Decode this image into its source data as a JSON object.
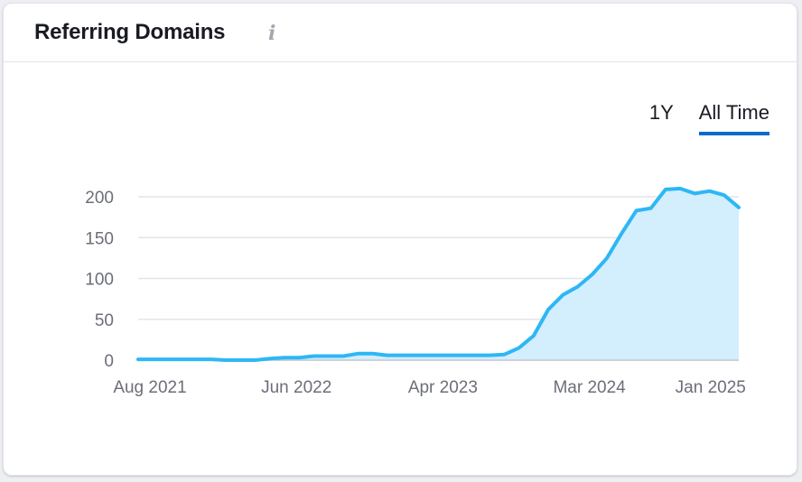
{
  "header": {
    "title": "Referring Domains",
    "info_icon": "info-icon"
  },
  "tabs": [
    {
      "label": "1Y",
      "active": false
    },
    {
      "label": "All Time",
      "active": true
    }
  ],
  "colors": {
    "line": "#2db7f5",
    "fill": "#d3eefc",
    "accent": "#006dca",
    "grid": "#e3e4ea"
  },
  "chart_data": {
    "type": "area",
    "title": "Referring Domains",
    "xlabel": "",
    "ylabel": "",
    "ylim": [
      0,
      200
    ],
    "yticks": [
      0,
      50,
      100,
      150,
      200
    ],
    "ytick_labels": [
      "0",
      "50",
      "100",
      "150",
      "200"
    ],
    "xtick_labels": [
      "Aug 2021",
      "Jun 2022",
      "Apr 2023",
      "Mar 2024",
      "Jan 2025"
    ],
    "xtick_positions": [
      0,
      10,
      20,
      30,
      40
    ],
    "grid": true,
    "legend": "none",
    "series": [
      {
        "name": "Referring Domains",
        "x": [
          0,
          1,
          2,
          3,
          4,
          5,
          6,
          7,
          8,
          9,
          10,
          11,
          12,
          13,
          14,
          15,
          16,
          17,
          18,
          19,
          20,
          21,
          22,
          23,
          24,
          25,
          26,
          27,
          28,
          29,
          30,
          31,
          32,
          33,
          34,
          35,
          36,
          37,
          38,
          39,
          40,
          41
        ],
        "values": [
          1,
          1,
          1,
          1,
          1,
          1,
          0,
          0,
          0,
          2,
          3,
          3,
          5,
          5,
          5,
          8,
          8,
          6,
          6,
          6,
          6,
          6,
          6,
          6,
          6,
          7,
          15,
          30,
          62,
          80,
          90,
          105,
          125,
          155,
          183,
          186,
          209,
          210,
          204,
          207,
          202,
          187
        ]
      }
    ]
  }
}
